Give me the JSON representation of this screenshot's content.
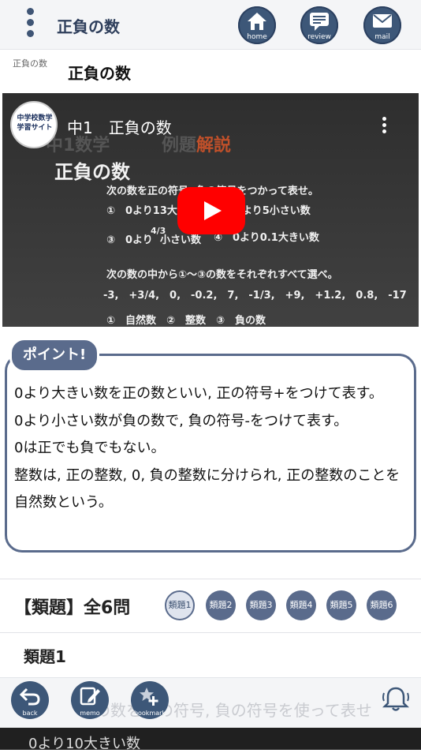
{
  "header": {
    "title": "正負の数",
    "nav": [
      {
        "label": "home",
        "icon": "home-icon"
      },
      {
        "label": "review",
        "icon": "review-icon"
      },
      {
        "label": "mail",
        "icon": "mail-icon"
      }
    ]
  },
  "breadcrumb": "正負の数",
  "page_title": "正負の数",
  "video": {
    "channel_logo_text": "中学校数学学習サイト",
    "title": "中1　正負の数",
    "ghost_left": "中1数学",
    "ghost_right_a": "例題",
    "ghost_right_b": "解説",
    "heading": "正負の数",
    "line1": "次の数を正の符号, 負の符号をつかって表せ。",
    "line2a": "①　0より13大き",
    "line2b": "より5小さい数",
    "line3a": "③　0より",
    "line3frac": "4/3",
    "line3b": "小さい数",
    "line3c": "④　0より0.1大きい数",
    "line4": "次の数の中から①～③の数をそれぞれすべて選べ。",
    "line5": "-3,　+3/4,　0,　-0.2,　7,　-1/3,　+9,　+1.2,　0.8,　-17",
    "line6": "①　自然数　②　整数　③　負の数"
  },
  "point": {
    "tag": "ポイント!",
    "lines": [
      "0より大きい数を正の数といい, 正の符号+をつけて表す。",
      "0より小さい数が負の数で, 負の符号-をつけて表す。",
      "0は正でも負でもない。",
      "整数は, 正の整数, 0, 負の整数に分けられ, 正の整数のことを自然数という。"
    ]
  },
  "quiz": {
    "count_label": "【類題】全6問",
    "buttons": [
      "類題1",
      "類題2",
      "類題3",
      "類題4",
      "類題5",
      "類題6"
    ],
    "active_index": 0,
    "current_title": "類題1",
    "faded_question": "次の数を正の符号, 負の符号を使って表せ",
    "next_line": "0より10大きい数"
  },
  "footer": {
    "buttons": [
      {
        "label": "back",
        "icon": "back-arrow-icon"
      },
      {
        "label": "memo",
        "icon": "memo-icon"
      },
      {
        "label": "bookmark",
        "icon": "bookmark-add-icon"
      }
    ],
    "bell_icon": "bell-icon"
  },
  "colors": {
    "accent": "#3d5778",
    "point": "#5a6b8c",
    "play": "#ff0000"
  }
}
